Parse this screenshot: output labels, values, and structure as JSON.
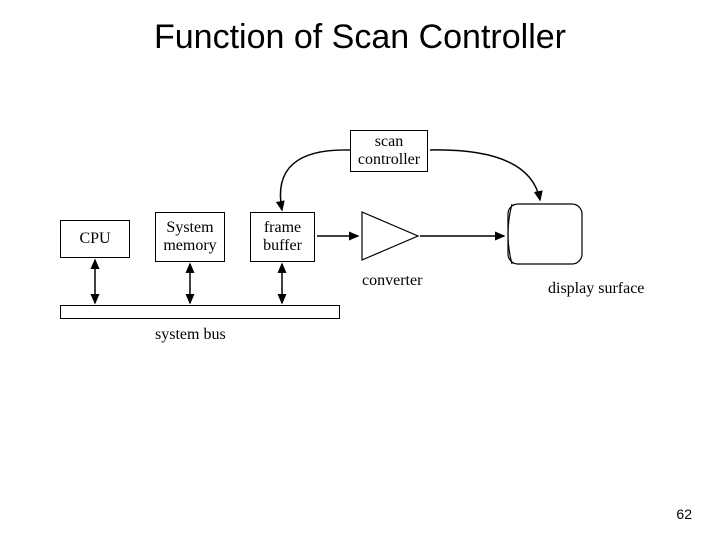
{
  "title": "Function of Scan Controller",
  "page_number": "62",
  "blocks": {
    "cpu": "CPU",
    "system_memory": "System\nmemory",
    "frame_buffer": "frame\nbuffer",
    "scan_controller": "scan\ncontroller",
    "converter_label": "converter",
    "system_bus_label": "system bus",
    "display_surface_label": "display\nsurface"
  }
}
